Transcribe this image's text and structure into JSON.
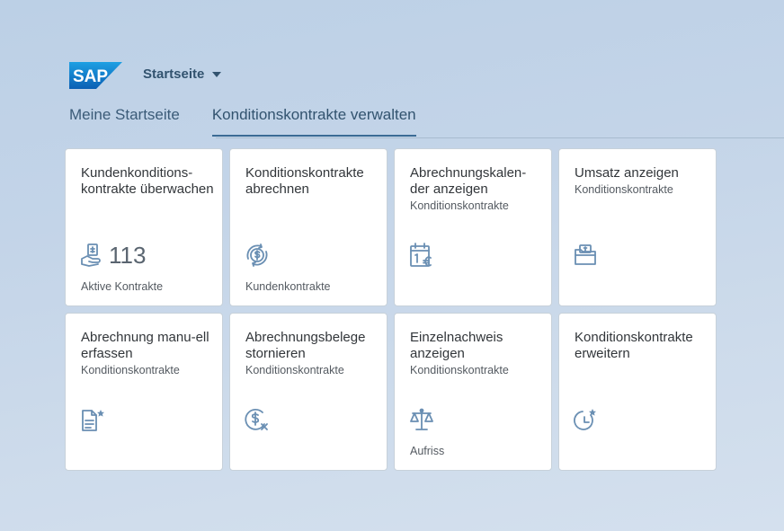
{
  "header": {
    "logo_text": "SAP",
    "home_title": "Startseite"
  },
  "tabs": [
    {
      "label": "Meine Startseite"
    },
    {
      "label": "Konditionskontrakte verwalten"
    }
  ],
  "tiles": [
    {
      "title": "Kundenkonditions-kontrakte überwachen",
      "subtitle": "",
      "kpi": "113",
      "footer": "Aktive Kontrakte",
      "icon": "money-hands-icon"
    },
    {
      "title": "Konditionskontrakte abrechnen",
      "subtitle": "",
      "kpi": "",
      "footer": "Kundenkontrakte",
      "icon": "money-cycle-icon"
    },
    {
      "title": "Abrechnungskalen-der anzeigen",
      "subtitle": "Konditionskontrakte",
      "kpi": "",
      "footer": "",
      "icon": "euro-calendar-icon"
    },
    {
      "title": "Umsatz anzeigen",
      "subtitle": "Konditionskontrakte",
      "kpi": "",
      "footer": "",
      "icon": "folder-money-icon"
    },
    {
      "title": "Abrechnung manu-ell erfassen",
      "subtitle": "Konditionskontrakte",
      "kpi": "",
      "footer": "",
      "icon": "document-star-icon"
    },
    {
      "title": "Abrechnungsbelege stornieren",
      "subtitle": "Konditionskontrakte",
      "kpi": "",
      "footer": "",
      "icon": "dollar-cancel-icon"
    },
    {
      "title": "Einzelnachweis anzeigen",
      "subtitle": "Konditionskontrakte",
      "kpi": "",
      "footer": "Aufriss",
      "icon": "scale-icon"
    },
    {
      "title": "Konditionskontrakte erweitern",
      "subtitle": "",
      "kpi": "",
      "footer": "",
      "icon": "clock-star-icon"
    }
  ],
  "colors": {
    "icon": "#6a8fb3",
    "brand": "#0a6ed1"
  }
}
